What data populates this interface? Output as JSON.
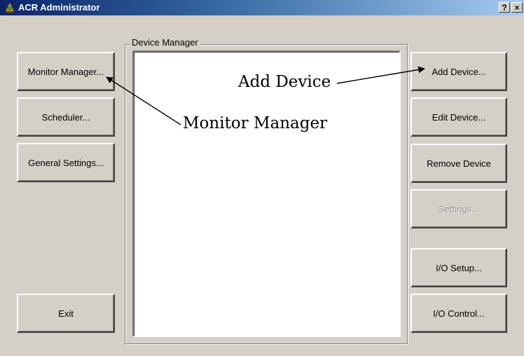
{
  "window": {
    "title": "ACR Administrator",
    "help_glyph": "?",
    "close_glyph": "×"
  },
  "left_buttons": {
    "monitor_manager": "Monitor Manager...",
    "scheduler": "Scheduler...",
    "general_settings": "General Settings...",
    "exit": "Exit"
  },
  "device_manager": {
    "group_label": "Device Manager"
  },
  "right_buttons": {
    "add_device": "Add Device...",
    "edit_device": "Edit Device...",
    "remove_device": "Remove Device",
    "settings": "Settings...",
    "settings_enabled": false,
    "io_setup": "I/O Setup...",
    "io_control": "I/O Control..."
  },
  "annotations": {
    "add_device": "Add Device",
    "monitor_manager": "Monitor Manager"
  },
  "colors": {
    "face": "#d4d0c8",
    "title_active": "#0a246a",
    "title_gradient_end": "#a6caf0"
  }
}
